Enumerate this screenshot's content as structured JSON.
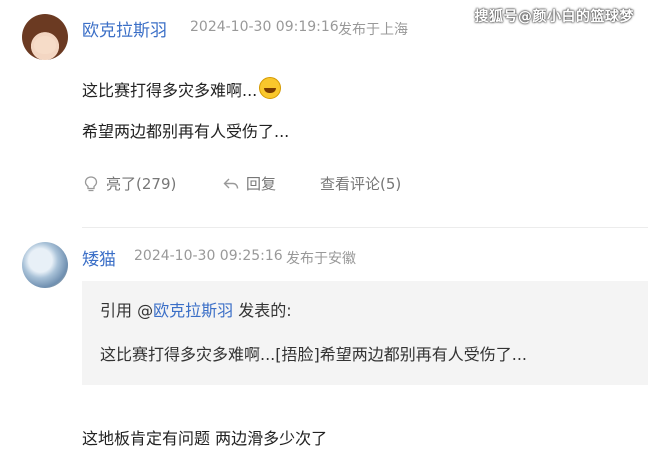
{
  "watermark": "搜狐号@颜小白的篮球梦",
  "comments": [
    {
      "username": "欧克拉斯羽",
      "timestamp": "2024-10-30 09:19:16",
      "location": "发布于上海",
      "lines": [
        "这比赛打得多灾多难啊...",
        "希望两边都别再有人受伤了..."
      ],
      "emoji_icon": "laughing-tears-emoji",
      "actions": {
        "like_label": "亮了(279)",
        "reply_label": "回复",
        "view_label": "查看评论(5)"
      }
    },
    {
      "username": "矮猫",
      "timestamp": "2024-10-30 09:25:16",
      "location": "发布于安徽",
      "quote": {
        "prefix": "引用 @",
        "quoted_user": "欧克拉斯羽",
        "suffix": " 发表的:",
        "text": "这比赛打得多灾多难啊...[捂脸]希望两边都别再有人受伤了..."
      },
      "line": "这地板肯定有问题 两边滑多少次了"
    }
  ],
  "colors": {
    "username": "#3b6fc7",
    "meta": "#999999",
    "quote_bg": "#f4f4f4"
  }
}
